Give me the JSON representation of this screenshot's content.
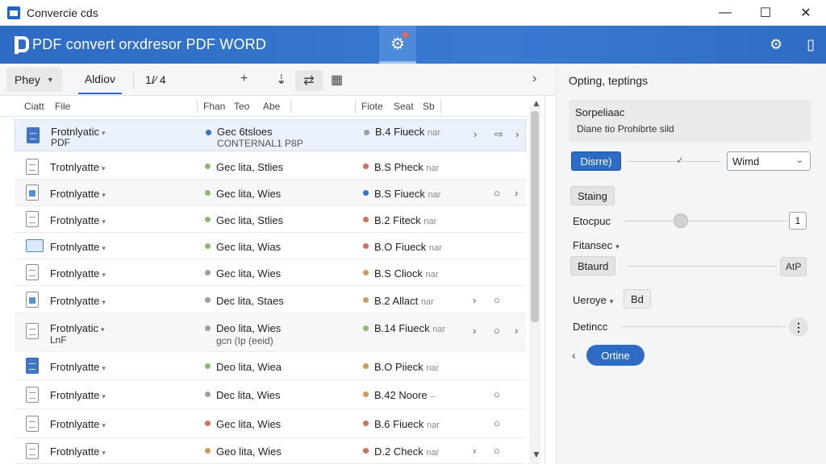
{
  "window": {
    "title": "Convercie cds",
    "controls": {
      "minimize": "—",
      "maximize": "☐",
      "close": "✕"
    }
  },
  "header": {
    "title": "PDF convert orxdresor PDF WORD",
    "center_icon": "gear-icon",
    "notification_color": "#ff5a4a",
    "right_icons": [
      "settings-gear-icon",
      "document-icon"
    ]
  },
  "toolbar": {
    "dropdown_label": "Phey",
    "tab_label": "Aldiov",
    "item_label": "1/⁄ 4",
    "plus_label": "+",
    "download_label": "⇣",
    "sort_label": "⇄",
    "grid_label": "▦",
    "next_label": "›"
  },
  "columns": {
    "c1": "Ciatt",
    "c2": "File",
    "c3": "Fhan",
    "c4": "Teo",
    "c5": "Abe",
    "c6": "Fiote",
    "c7": "Seat",
    "c8": "Sb"
  },
  "rows": [
    {
      "name": "Frotnlyatic",
      "name2": "PDF",
      "col2": "Gec 6tsloes",
      "col2b": "CONTERNAL1 P8P",
      "dot2": "#3b6fd0",
      "col3": "B.4 Fiueck",
      "col3b": "nar",
      "dot3": "#9aa0a6",
      "icon": "document-icon",
      "actions": [
        "›",
        "⇨",
        "›"
      ]
    },
    {
      "name": "Trotnlyatte",
      "col2": "Gec lita, Stlies",
      "dot2": "#8fb86a",
      "col3": "B.S Pheck",
      "col3b": "nar",
      "dot3": "#d0735a",
      "icon": "document-icon",
      "actions": []
    },
    {
      "name": "Frotnlyatte",
      "col2": "Gec lita, Wies",
      "dot2": "#8fb86a",
      "col3": "B.S Fiueck",
      "col3b": "nar",
      "dot3": "#3b6fd0",
      "icon": "pin-icon",
      "actions": [
        "○",
        "›"
      ]
    },
    {
      "name": "Frotnlyatte",
      "col2": "Gec lita, Stlies",
      "dot2": "#8fb86a",
      "col3": "B.2 Fiteck",
      "col3b": "nar",
      "dot3": "#d0735a",
      "icon": "document-icon",
      "actions": []
    },
    {
      "name": "Frotnlyatte",
      "col2": "Gec lita, Wias",
      "dot2": "#8fb86a",
      "col3": "B.O Fiueck",
      "col3b": "nar",
      "dot3": "#d0735a",
      "icon": "folder-icon",
      "actions": []
    },
    {
      "name": "Frotnlyatte",
      "col2": "Gec lita, Wies",
      "dot2": "#9aa0a6",
      "col3": "B.S Cliock",
      "col3b": "nar",
      "dot3": "#d09a5a",
      "icon": "document-icon",
      "actions": []
    },
    {
      "name": "Frotnlyatte",
      "col2": "Dec lita, Staes",
      "dot2": "#9aa0a6",
      "col3": "B.2 Allact",
      "col3b": "nar",
      "dot3": "#d09a5a",
      "icon": "image-icon",
      "actions": [
        "›",
        "○"
      ]
    },
    {
      "name": "Frotnlyatic",
      "name2": "LnF",
      "col2": "Deo lita, Wies",
      "col2b": "gcn (Ip (eeid)",
      "dot2": "#9aa0a6",
      "col3": "B.14 Fiueck",
      "col3b": "nar",
      "dot3": "#8fb86a",
      "icon": "document-icon",
      "actions": [
        "›",
        "○",
        "›"
      ]
    },
    {
      "name": "Frotnlyatte",
      "col2": "Deo lita, Wiea",
      "dot2": "#8fb86a",
      "col3": "B.O Piieck",
      "col3b": "nar",
      "dot3": "#d09a5a",
      "icon": "pdf-blue-icon",
      "actions": []
    },
    {
      "name": "Frotnlyatte",
      "col2": "Dec lita, Wies",
      "dot2": "#9aa0a6",
      "col3": "B.42 Noore",
      "col3b": "–",
      "dot3": "#d09a5a",
      "icon": "document-icon",
      "actions": [
        "○"
      ]
    },
    {
      "name": "Frotnlyatte",
      "col2": "Gec lita, Wies",
      "dot2": "#d0735a",
      "col3": "B.6 Fiueck",
      "col3b": "nar",
      "dot3": "#d0735a",
      "icon": "document-icon",
      "actions": [
        "○"
      ]
    },
    {
      "name": "Frotnlyatte",
      "col2": "Geo lita, Wies",
      "dot2": "#d09a5a",
      "col3": "D.2 Check",
      "col3b": "nar",
      "dot3": "#d0735a",
      "icon": "document-icon",
      "actions": [
        "›",
        "○"
      ]
    }
  ],
  "panel": {
    "title": "Opting, teptings",
    "summary_title": "Sorpeliaac",
    "summary_text": "Diane tio Prohibrte sild",
    "primary_btn": "Disrre)",
    "check_mark": "✓",
    "select_value": "Wimd",
    "staing_label": "Staing",
    "etocpuc_label": "Etocpuc",
    "etocpuc_box": "1",
    "fitansec_label": "Fitansec",
    "btaurd_label": "Btaurd",
    "btaurd_value": "AtP",
    "ueroye_label": "Ueroye",
    "ueroye_value": "Bd",
    "detincc_label": "Detincc",
    "ortine_btn": "Ortine",
    "back_label": "‹"
  },
  "colors": {
    "accent": "#2d6bc4",
    "header": "#3a7ad3",
    "panel": "#f4f5f6"
  }
}
